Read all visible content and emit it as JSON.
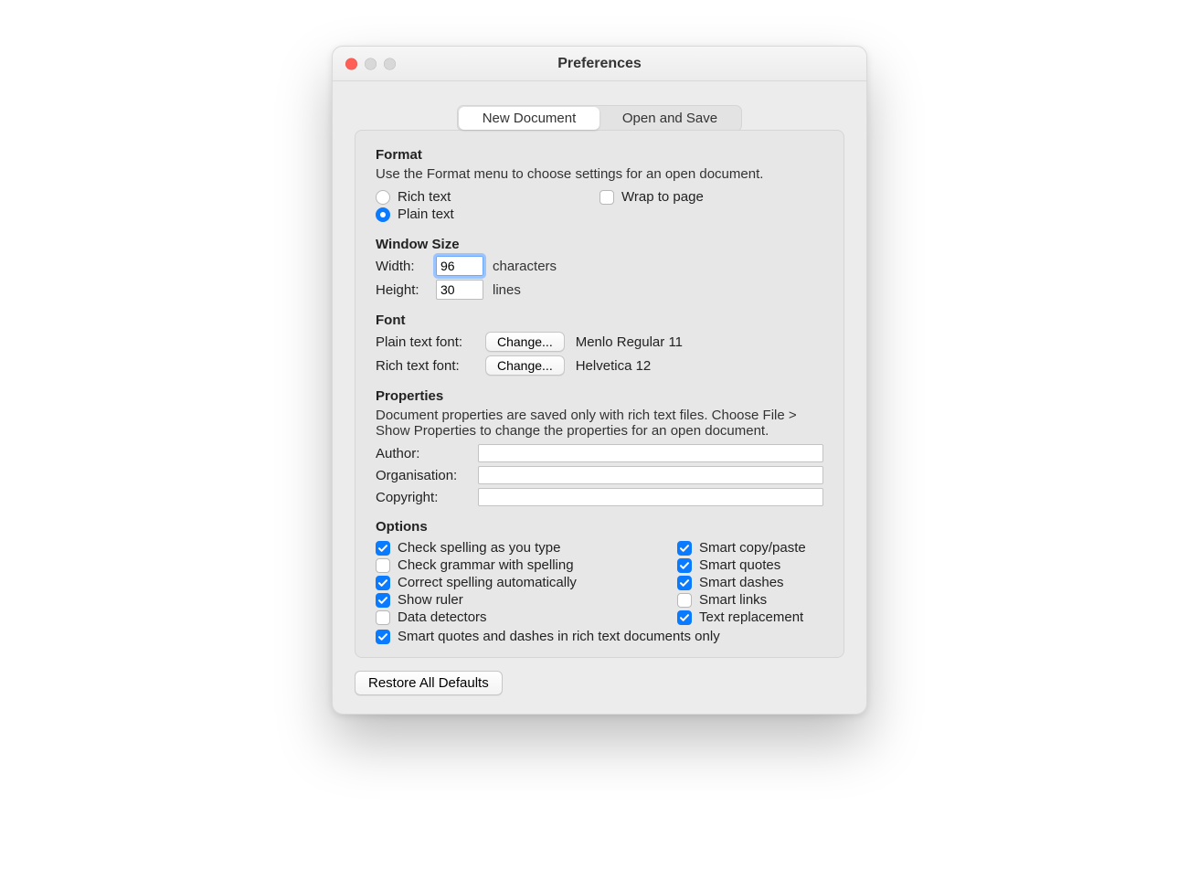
{
  "title": "Preferences",
  "tabs": {
    "new_document": "New Document",
    "open_and_save": "Open and Save"
  },
  "format": {
    "heading": "Format",
    "help": "Use the Format menu to choose settings for an open document.",
    "rich_text": "Rich text",
    "plain_text": "Plain text",
    "wrap_to_page": "Wrap to page"
  },
  "window_size": {
    "heading": "Window Size",
    "width_label": "Width:",
    "width_value": "96",
    "width_unit": "characters",
    "height_label": "Height:",
    "height_value": "30",
    "height_unit": "lines"
  },
  "font": {
    "heading": "Font",
    "plain_label": "Plain text font:",
    "rich_label": "Rich text font:",
    "change": "Change...",
    "plain_value": "Menlo Regular 11",
    "rich_value": "Helvetica 12"
  },
  "properties": {
    "heading": "Properties",
    "help": "Document properties are saved only with rich text files. Choose File > Show Properties to change the properties for an open document.",
    "author_label": "Author:",
    "organisation_label": "Organisation:",
    "copyright_label": "Copyright:",
    "author_value": "",
    "organisation_value": "",
    "copyright_value": ""
  },
  "options": {
    "heading": "Options",
    "check_spelling": "Check spelling as you type",
    "check_grammar": "Check grammar with spelling",
    "correct_spelling": "Correct spelling automatically",
    "show_ruler": "Show ruler",
    "data_detectors": "Data detectors",
    "smart_copy_paste": "Smart copy/paste",
    "smart_quotes": "Smart quotes",
    "smart_dashes": "Smart dashes",
    "smart_links": "Smart links",
    "text_replacement": "Text replacement",
    "smart_rich_only": "Smart quotes and dashes in rich text documents only"
  },
  "restore": "Restore All Defaults"
}
